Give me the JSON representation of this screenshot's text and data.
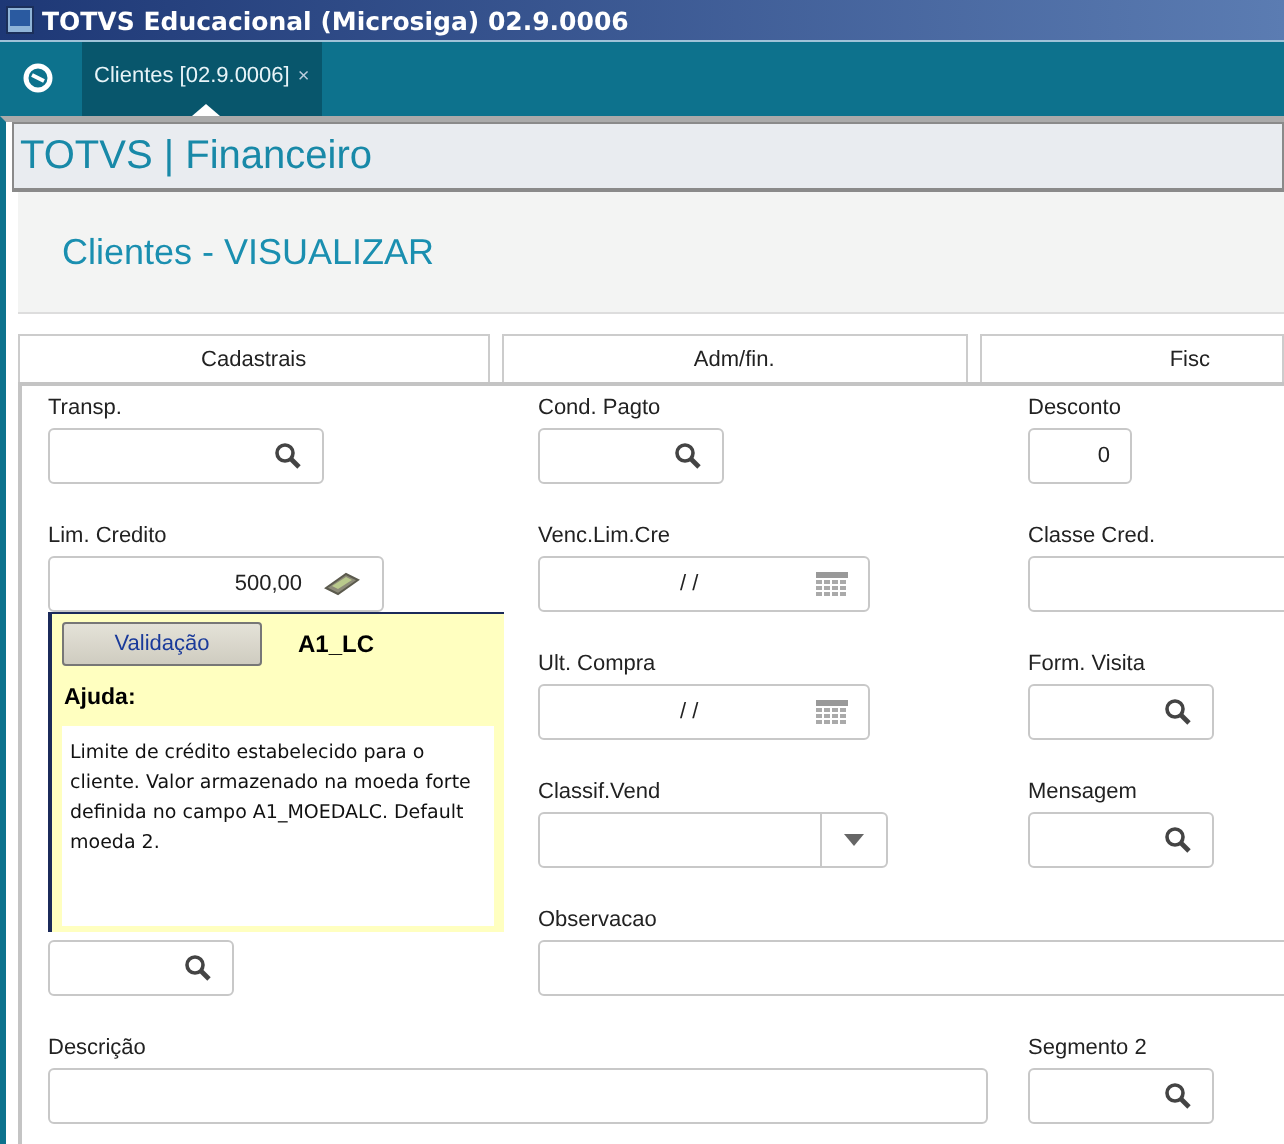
{
  "window": {
    "title": "TOTVS Educacional (Microsiga) 02.9.0006"
  },
  "doc_tabs": [
    {
      "label": "Clientes [02.9.0006]",
      "close": "×",
      "selected": true
    }
  ],
  "module_title": "TOTVS | Financeiro",
  "page_title": "Clientes - VISUALIZAR",
  "section_tabs": [
    {
      "label": "Cadastrais"
    },
    {
      "label": "Adm/fin."
    },
    {
      "label": "Fisc"
    }
  ],
  "fields": [
    {
      "label": "Transp.",
      "kind": "search"
    },
    {
      "label": "Cond. Pagto",
      "kind": "search"
    },
    {
      "label": "Desconto",
      "kind": "number",
      "value": "0"
    },
    {
      "label": "Lim. Credito",
      "kind": "money",
      "value": "500,00"
    },
    {
      "label": "Venc.Lim.Cre",
      "kind": "date",
      "value": "/ /"
    },
    {
      "label": "Classe Cred.",
      "kind": "text"
    },
    {
      "label": "Ult. Compra",
      "kind": "date",
      "value": "/ /"
    },
    {
      "label": "Form. Visita",
      "kind": "search"
    },
    {
      "label": "Classif.Vend",
      "kind": "select"
    },
    {
      "label": "Mensagem",
      "kind": "search"
    },
    {
      "kind": "search"
    },
    {
      "label": "Observacao",
      "kind": "text"
    },
    {
      "label": "Descrição",
      "kind": "text"
    },
    {
      "label": "Segmento 2",
      "kind": "search"
    }
  ],
  "help_popup": {
    "button": "Validação",
    "field_code": "A1_LC",
    "heading": "Ajuda:",
    "text": "Limite de crédito estabelecido para o cliente. Valor armazenado na moeda forte definida no campo A1_MOEDALC. Default moeda 2."
  }
}
